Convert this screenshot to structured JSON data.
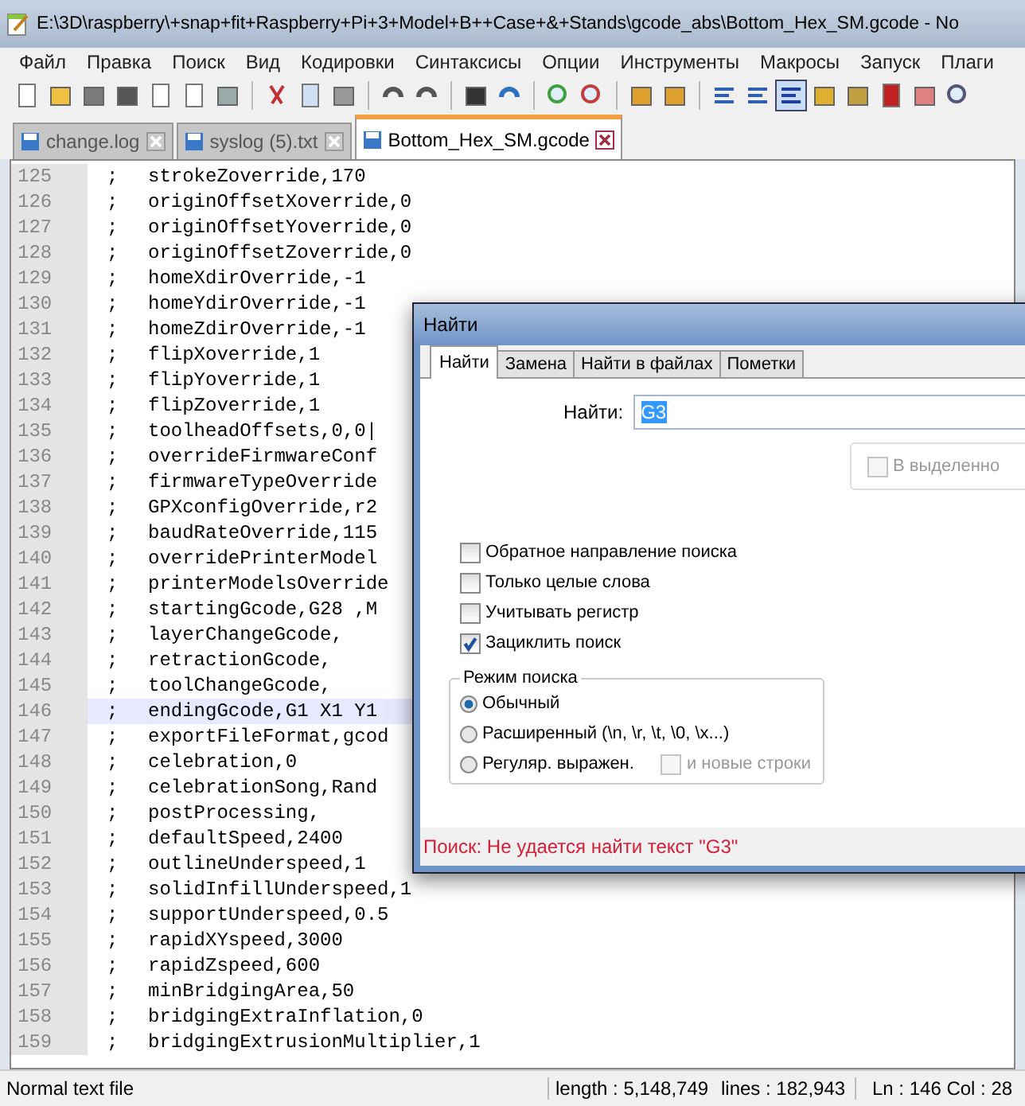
{
  "window": {
    "title": "E:\\3D\\raspberry\\+snap+fit+Raspberry+Pi+3+Model+B++Case+&+Stands\\gcode_abs\\Bottom_Hex_SM.gcode - No"
  },
  "menu": [
    "Файл",
    "Правка",
    "Поиск",
    "Вид",
    "Кодировки",
    "Синтаксисы",
    "Опции",
    "Инструменты",
    "Макросы",
    "Запуск",
    "Плаги"
  ],
  "tabs": [
    {
      "label": "change.log",
      "selected": false
    },
    {
      "label": "syslog (5).txt",
      "selected": false
    },
    {
      "label": "Bottom_Hex_SM.gcode",
      "selected": true
    }
  ],
  "editor": {
    "lines": [
      {
        "number": "125",
        "mark": ";",
        "text": "strokeZoverride,170",
        "current": false
      },
      {
        "number": "126",
        "mark": ";",
        "text": "originOffsetXoverride,0",
        "current": false
      },
      {
        "number": "127",
        "mark": ";",
        "text": "originOffsetYoverride,0",
        "current": false
      },
      {
        "number": "128",
        "mark": ";",
        "text": "originOffsetZoverride,0",
        "current": false
      },
      {
        "number": "129",
        "mark": ";",
        "text": "homeXdirOverride,-1",
        "current": false
      },
      {
        "number": "130",
        "mark": ";",
        "text": "homeYdirOverride,-1",
        "current": false
      },
      {
        "number": "131",
        "mark": ";",
        "text": "homeZdirOverride,-1",
        "current": false
      },
      {
        "number": "132",
        "mark": ";",
        "text": "flipXoverride,1",
        "current": false
      },
      {
        "number": "133",
        "mark": ";",
        "text": "flipYoverride,1",
        "current": false
      },
      {
        "number": "134",
        "mark": ";",
        "text": "flipZoverride,1",
        "current": false
      },
      {
        "number": "135",
        "mark": ";",
        "text": "toolheadOffsets,0,0|",
        "current": false
      },
      {
        "number": "136",
        "mark": ";",
        "text": "overrideFirmwareConf",
        "current": false
      },
      {
        "number": "137",
        "mark": ";",
        "text": "firmwareTypeOverride",
        "current": false
      },
      {
        "number": "138",
        "mark": ";",
        "text": "GPXconfigOverride,r2",
        "current": false
      },
      {
        "number": "139",
        "mark": ";",
        "text": "baudRateOverride,115",
        "current": false
      },
      {
        "number": "140",
        "mark": ";",
        "text": "overridePrinterModel",
        "current": false
      },
      {
        "number": "141",
        "mark": ";",
        "text": "printerModelsOverride",
        "current": false
      },
      {
        "number": "142",
        "mark": ";",
        "text": "startingGcode,G28 ,M",
        "current": false
      },
      {
        "number": "143",
        "mark": ";",
        "text": "layerChangeGcode,",
        "current": false
      },
      {
        "number": "144",
        "mark": ";",
        "text": "retractionGcode,",
        "current": false
      },
      {
        "number": "145",
        "mark": ";",
        "text": "toolChangeGcode,",
        "current": false
      },
      {
        "number": "146",
        "mark": ";",
        "text": "endingGcode,G1 X1 Y1",
        "current": true
      },
      {
        "number": "147",
        "mark": ";",
        "text": "exportFileFormat,gcod",
        "current": false
      },
      {
        "number": "148",
        "mark": ";",
        "text": "celebration,0",
        "current": false
      },
      {
        "number": "149",
        "mark": ";",
        "text": "celebrationSong,Rand",
        "current": false
      },
      {
        "number": "150",
        "mark": ";",
        "text": "postProcessing,",
        "current": false
      },
      {
        "number": "151",
        "mark": ";",
        "text": "defaultSpeed,2400",
        "current": false
      },
      {
        "number": "152",
        "mark": ";",
        "text": "outlineUnderspeed,1",
        "current": false
      },
      {
        "number": "153",
        "mark": ";",
        "text": "solidInfillUnderspeed,1",
        "current": false
      },
      {
        "number": "154",
        "mark": ";",
        "text": "supportUnderspeed,0.5",
        "current": false
      },
      {
        "number": "155",
        "mark": ";",
        "text": "rapidXYspeed,3000",
        "current": false
      },
      {
        "number": "156",
        "mark": ";",
        "text": "rapidZspeed,600",
        "current": false
      },
      {
        "number": "157",
        "mark": ";",
        "text": "minBridgingArea,50",
        "current": false
      },
      {
        "number": "158",
        "mark": ";",
        "text": "bridgingExtraInflation,0",
        "current": false
      },
      {
        "number": "159",
        "mark": ";",
        "text": "bridgingExtrusionMultiplier,1",
        "current": false
      }
    ]
  },
  "dialog": {
    "title": "Найти",
    "tabs": [
      {
        "label": "Найти",
        "selected": true
      },
      {
        "label": "Замена",
        "selected": false
      },
      {
        "label": "Найти в файлах",
        "selected": false
      },
      {
        "label": "Пометки",
        "selected": false
      }
    ],
    "find_label": "Найти:",
    "find_value": "G3",
    "in_selection": {
      "label": "В выделенно",
      "checked": false,
      "disabled": true
    },
    "options": [
      {
        "label": "Обратное направление поиска",
        "checked": false
      },
      {
        "label": "Только целые слова",
        "checked": false
      },
      {
        "label": "Учитывать регистр",
        "checked": false
      },
      {
        "label": "Зациклить поиск",
        "checked": true
      }
    ],
    "mode": {
      "title": "Режим поиска",
      "options": [
        {
          "label": "Обычный",
          "selected": true
        },
        {
          "label": "Расширенный (\\n, \\r, \\t, \\0, \\x...)",
          "selected": false
        },
        {
          "label": "Регуляр. выражен.",
          "selected": false
        }
      ],
      "newlines": {
        "label": "и новые строки",
        "checked": false,
        "disabled": true
      }
    },
    "message": "Поиск: Не удается найти текст \"G3\""
  },
  "status_bar": {
    "type": "Normal text file",
    "length": "length : 5,148,749",
    "lines": "lines : 182,943",
    "position": "Ln : 146    Col : 28"
  }
}
